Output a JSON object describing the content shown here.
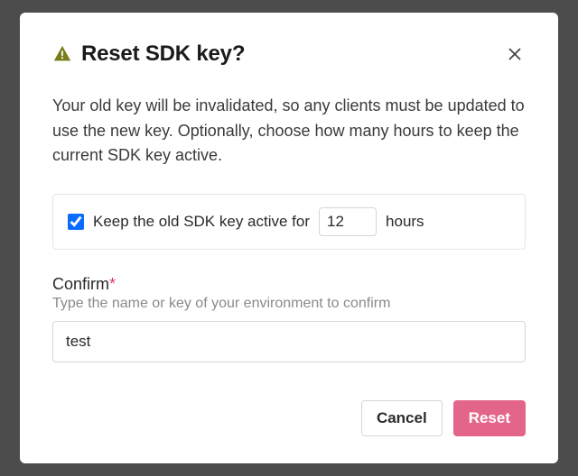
{
  "modal": {
    "title": "Reset SDK key?",
    "description": "Your old key will be invalidated, so any clients must be updated to use the new key. Optionally, choose how many hours to keep the current SDK key active.",
    "keep_active": {
      "checked": true,
      "label_prefix": "Keep the old SDK key active for",
      "hours_value": "12",
      "label_suffix": "hours"
    },
    "confirm": {
      "label": "Confirm",
      "required_mark": "*",
      "hint": "Type the name or key of your environment to confirm",
      "value": "test"
    },
    "buttons": {
      "cancel": "Cancel",
      "reset": "Reset"
    }
  }
}
